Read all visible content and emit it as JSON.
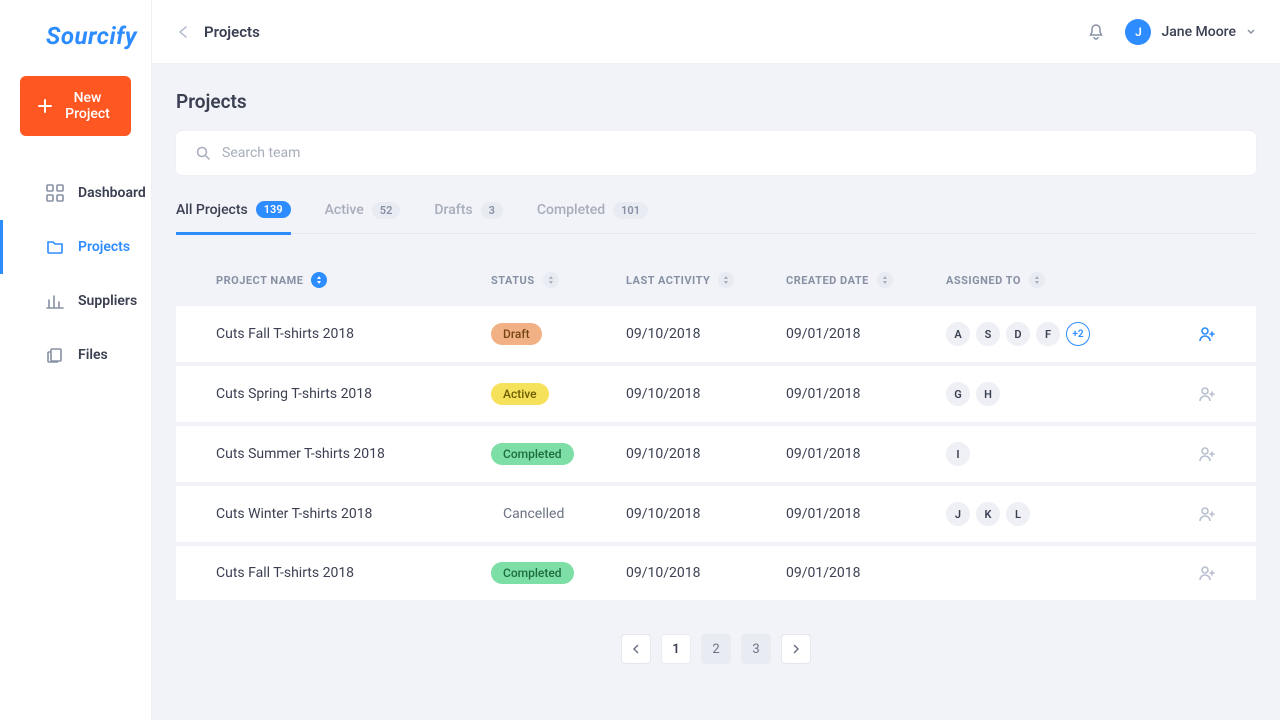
{
  "brand": "Sourcify",
  "user": {
    "name": "Jane Moore",
    "initial": "J"
  },
  "sidebar": {
    "new_project_btn": "New Project",
    "items": [
      {
        "label": "Dashboard"
      },
      {
        "label": "Projects"
      },
      {
        "label": "Suppliers"
      },
      {
        "label": "Files"
      }
    ]
  },
  "breadcrumb": "Projects",
  "page_title": "Projects",
  "search": {
    "placeholder": "Search team"
  },
  "tabs": [
    {
      "label": "All Projects",
      "count": "139"
    },
    {
      "label": "Active",
      "count": "52"
    },
    {
      "label": "Drafts",
      "count": "3"
    },
    {
      "label": "Completed",
      "count": "101"
    }
  ],
  "columns": {
    "name": "PROJECT NAME",
    "status": "STATUS",
    "last_activity": "LAST ACTIVITY",
    "created": "CREATED DATE",
    "assigned": "ASSIGNED TO"
  },
  "rows": [
    {
      "name": "Cuts Fall T-shirts 2018",
      "status": "Draft",
      "status_class": "status-draft",
      "last_activity": "09/10/2018",
      "created": "09/01/2018",
      "assignees": [
        "A",
        "S",
        "D",
        "F"
      ],
      "more": "+2",
      "hover": true
    },
    {
      "name": "Cuts Spring T-shirts 2018",
      "status": "Active",
      "status_class": "status-active",
      "last_activity": "09/10/2018",
      "created": "09/01/2018",
      "assignees": [
        "G",
        "H"
      ],
      "more": null,
      "hover": false
    },
    {
      "name": "Cuts Summer T-shirts 2018",
      "status": "Completed",
      "status_class": "status-completed",
      "last_activity": "09/10/2018",
      "created": "09/01/2018",
      "assignees": [
        "I"
      ],
      "more": null,
      "hover": false
    },
    {
      "name": "Cuts Winter T-shirts 2018",
      "status": "Cancelled",
      "status_class": "status-cancelled",
      "last_activity": "09/10/2018",
      "created": "09/01/2018",
      "assignees": [
        "J",
        "K",
        "L"
      ],
      "more": null,
      "hover": false
    },
    {
      "name": "Cuts Fall T-shirts 2018",
      "status": "Completed",
      "status_class": "status-completed",
      "last_activity": "09/10/2018",
      "created": "09/01/2018",
      "assignees": [],
      "more": null,
      "hover": false
    }
  ],
  "pagination": {
    "current": "1",
    "pages": [
      "1",
      "2",
      "3"
    ]
  }
}
